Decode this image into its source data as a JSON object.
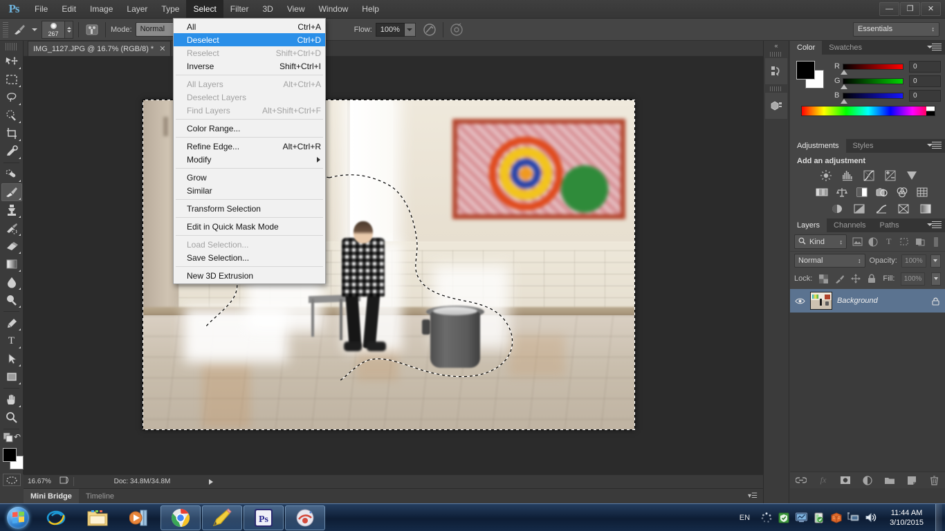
{
  "app": {
    "logo": "Ps",
    "menus": [
      "File",
      "Edit",
      "Image",
      "Layer",
      "Type",
      "Select",
      "Filter",
      "3D",
      "View",
      "Window",
      "Help"
    ],
    "active_menu": "Select",
    "window_buttons": {
      "minimize": "—",
      "restore": "❐",
      "close": "✕"
    }
  },
  "options_bar": {
    "brush_size": "267",
    "mode_label": "Mode:",
    "mode_value": "Normal",
    "flow_label": "Flow:",
    "flow_value": "100%",
    "workspace": "Essentials"
  },
  "select_menu": {
    "groups": [
      [
        {
          "label": "All",
          "shortcut": "Ctrl+A",
          "disabled": false,
          "highlighted": false
        },
        {
          "label": "Deselect",
          "shortcut": "Ctrl+D",
          "disabled": false,
          "highlighted": true
        },
        {
          "label": "Reselect",
          "shortcut": "Shift+Ctrl+D",
          "disabled": true,
          "highlighted": false
        },
        {
          "label": "Inverse",
          "shortcut": "Shift+Ctrl+I",
          "disabled": false,
          "highlighted": false
        }
      ],
      [
        {
          "label": "All Layers",
          "shortcut": "Alt+Ctrl+A",
          "disabled": true,
          "highlighted": false
        },
        {
          "label": "Deselect Layers",
          "shortcut": "",
          "disabled": true,
          "highlighted": false
        },
        {
          "label": "Find Layers",
          "shortcut": "Alt+Shift+Ctrl+F",
          "disabled": true,
          "highlighted": false
        }
      ],
      [
        {
          "label": "Color Range...",
          "shortcut": "",
          "disabled": false,
          "highlighted": false
        }
      ],
      [
        {
          "label": "Refine Edge...",
          "shortcut": "Alt+Ctrl+R",
          "disabled": false,
          "highlighted": false
        },
        {
          "label": "Modify",
          "shortcut": "",
          "disabled": false,
          "highlighted": false,
          "submenu": true
        }
      ],
      [
        {
          "label": "Grow",
          "shortcut": "",
          "disabled": false,
          "highlighted": false
        },
        {
          "label": "Similar",
          "shortcut": "",
          "disabled": false,
          "highlighted": false
        }
      ],
      [
        {
          "label": "Transform Selection",
          "shortcut": "",
          "disabled": false,
          "highlighted": false
        }
      ],
      [
        {
          "label": "Edit in Quick Mask Mode",
          "shortcut": "",
          "disabled": false,
          "highlighted": false
        }
      ],
      [
        {
          "label": "Load Selection...",
          "shortcut": "",
          "disabled": true,
          "highlighted": false
        },
        {
          "label": "Save Selection...",
          "shortcut": "",
          "disabled": false,
          "highlighted": false
        }
      ],
      [
        {
          "label": "New 3D Extrusion",
          "shortcut": "",
          "disabled": false,
          "highlighted": false
        }
      ]
    ]
  },
  "toolbar": {
    "tools": [
      {
        "name": "move-tool",
        "glyph": "move"
      },
      {
        "name": "rectangular-marquee-tool",
        "glyph": "marquee"
      },
      {
        "name": "lasso-tool",
        "glyph": "lasso"
      },
      {
        "name": "quick-selection-tool",
        "glyph": "quickselect"
      },
      {
        "name": "crop-tool",
        "glyph": "crop"
      },
      {
        "name": "eyedropper-tool",
        "glyph": "eyedropper"
      },
      {
        "name": "spot-healing-brush-tool",
        "glyph": "heal"
      },
      {
        "name": "brush-tool",
        "glyph": "brush",
        "selected": true
      },
      {
        "name": "clone-stamp-tool",
        "glyph": "stamp"
      },
      {
        "name": "history-brush-tool",
        "glyph": "historybrush"
      },
      {
        "name": "eraser-tool",
        "glyph": "eraser"
      },
      {
        "name": "gradient-tool",
        "glyph": "gradient"
      },
      {
        "name": "blur-tool",
        "glyph": "blur"
      },
      {
        "name": "dodge-tool",
        "glyph": "dodge"
      },
      {
        "name": "pen-tool",
        "glyph": "pen"
      },
      {
        "name": "type-tool",
        "glyph": "type"
      },
      {
        "name": "path-selection-tool",
        "glyph": "pathselect"
      },
      {
        "name": "rectangle-tool",
        "glyph": "rectangle"
      },
      {
        "name": "hand-tool",
        "glyph": "hand"
      },
      {
        "name": "zoom-tool",
        "glyph": "zoom"
      }
    ],
    "foreground_color": "#000000",
    "background_color": "#ffffff"
  },
  "document": {
    "tab_title": "IMG_1127.JPG @ 16.7% (RGB/8) *",
    "close_glyph": "✕"
  },
  "status_bar": {
    "zoom": "16.67%",
    "doc_info": "Doc: 34.8M/34.8M"
  },
  "bottom_tabs": [
    {
      "label": "Mini Bridge",
      "active": true
    },
    {
      "label": "Timeline",
      "active": false
    }
  ],
  "color_panel": {
    "tabs": [
      "Color",
      "Swatches"
    ],
    "active_tab": "Color",
    "channels": [
      {
        "label": "R",
        "value": "0"
      },
      {
        "label": "G",
        "value": "0"
      },
      {
        "label": "B",
        "value": "0"
      }
    ]
  },
  "adjustments_panel": {
    "tabs": [
      "Adjustments",
      "Styles"
    ],
    "active_tab": "Adjustments",
    "title": "Add an adjustment",
    "icons": [
      [
        "brightness-contrast-icon",
        "levels-icon",
        "curves-icon",
        "exposure-icon",
        "vibrance-icon"
      ],
      [
        "hue-saturation-icon",
        "color-balance-icon",
        "black-white-icon",
        "photo-filter-icon",
        "channel-mixer-icon",
        "color-lookup-icon"
      ],
      [
        "invert-icon",
        "posterize-icon",
        "threshold-icon",
        "selective-color-icon",
        "gradient-map-icon"
      ]
    ]
  },
  "layers_panel": {
    "tabs": [
      "Layers",
      "Channels",
      "Paths"
    ],
    "active_tab": "Layers",
    "filter_kind": "Kind",
    "blend_mode": "Normal",
    "opacity_label": "Opacity:",
    "opacity_value": "100%",
    "lock_label": "Lock:",
    "fill_label": "Fill:",
    "fill_value": "100%",
    "layers": [
      {
        "name": "Background",
        "locked": true,
        "visible": true,
        "selected": true
      }
    ],
    "bottom_icons": [
      "link-layers-icon",
      "layer-style-icon",
      "layer-mask-icon",
      "adjustment-layer-icon",
      "new-group-icon",
      "new-layer-icon",
      "delete-layer-icon"
    ]
  },
  "taskbar": {
    "start": "start-orb-icon",
    "items": [
      {
        "name": "internet-explorer-icon",
        "running": false
      },
      {
        "name": "file-explorer-icon",
        "running": false
      },
      {
        "name": "windows-media-player-icon",
        "running": false
      },
      {
        "name": "google-chrome-icon",
        "running": true
      },
      {
        "name": "notepad-plus-icon",
        "running": true
      },
      {
        "name": "photoshop-icon",
        "running": true
      },
      {
        "name": "other-app-icon",
        "running": true
      }
    ],
    "language": "EN",
    "tray_icons": [
      "loading-icon",
      "security-shield-icon",
      "network-monitor-icon",
      "battery-icon",
      "database-icon",
      "network-icon",
      "volume-icon"
    ],
    "time": "11:44 AM",
    "date": "3/10/2015"
  },
  "canvas": {
    "selection_active": true
  }
}
